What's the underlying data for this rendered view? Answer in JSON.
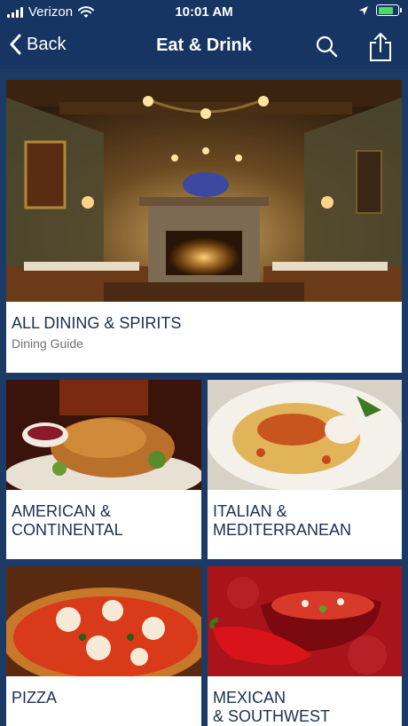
{
  "status_bar": {
    "carrier": "Verizon",
    "time": "10:01 AM",
    "battery_level": 0.8
  },
  "nav": {
    "back_label": "Back",
    "title": "Eat & Drink",
    "icons": [
      "chevron-left-icon",
      "search-icon",
      "share-icon"
    ]
  },
  "featured": {
    "title": "ALL DINING & SPIRITS",
    "subtitle": "Dining Guide",
    "image": "dining-room-photo"
  },
  "categories": [
    {
      "title": "AMERICAN &\nCONTINENTAL",
      "image": "roast-turkey-photo"
    },
    {
      "title": "ITALIAN &\nMEDITERRANEAN",
      "image": "pasta-photo"
    },
    {
      "title": "PIZZA",
      "image": "pizza-photo"
    },
    {
      "title": "MEXICAN\n& SOUTHWEST",
      "image": "chili-salsa-photo"
    }
  ],
  "colors": {
    "nav_background": "#163563",
    "page_background": "#1b3a66",
    "card_title": "#1c2f52",
    "battery": "#4cd964"
  }
}
